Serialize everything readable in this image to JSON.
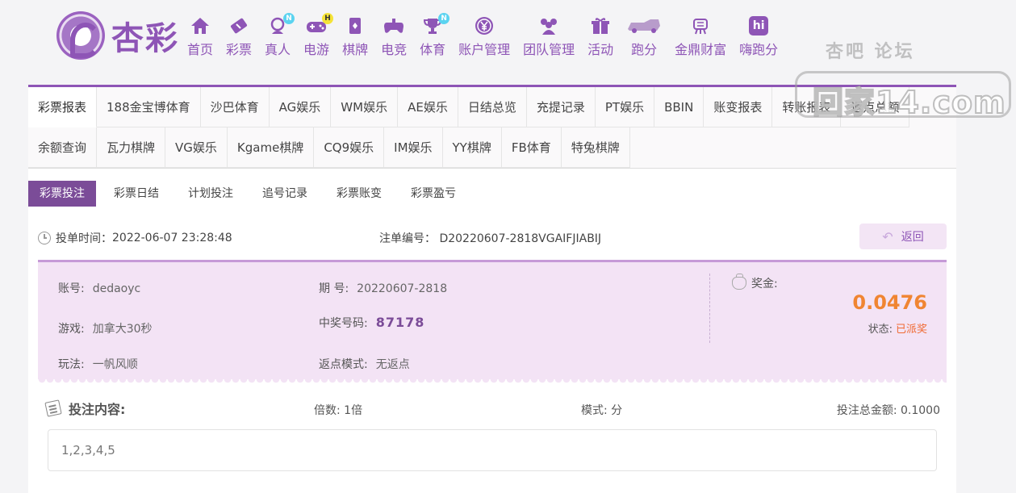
{
  "brand": {
    "name": "杏彩"
  },
  "nav": [
    {
      "label": "首页",
      "icon": "home-icon"
    },
    {
      "label": "彩票",
      "icon": "ticket-icon"
    },
    {
      "label": "真人",
      "icon": "person-icon",
      "badge": "N"
    },
    {
      "label": "电游",
      "icon": "gamepad-icon",
      "badge": "H"
    },
    {
      "label": "棋牌",
      "icon": "cards-icon"
    },
    {
      "label": "电竞",
      "icon": "controller-icon"
    },
    {
      "label": "体育",
      "icon": "trophy-icon",
      "badge": "N"
    },
    {
      "label": "账户管理",
      "icon": "yen-icon"
    },
    {
      "label": "团队管理",
      "icon": "team-icon"
    },
    {
      "label": "活动",
      "icon": "gift-icon"
    },
    {
      "label": "跑分",
      "icon": "vehicle-icon"
    },
    {
      "label": "金鼎财富",
      "icon": "ding-icon"
    },
    {
      "label": "嗨跑分",
      "icon": "hi-logo-icon",
      "logo_text": "hi"
    }
  ],
  "watermark": {
    "top": "杏吧    论坛",
    "main": "回家14.com"
  },
  "tabs_row1": [
    "彩票报表",
    "188金宝博体育",
    "沙巴体育",
    "AG娱乐",
    "WM娱乐",
    "AE娱乐",
    "日结总览",
    "充提记录",
    "PT娱乐",
    "BBIN",
    "账变报表",
    "转账报表",
    "返点总额"
  ],
  "tabs_row2": [
    "余额查询",
    "瓦力棋牌",
    "VG娱乐",
    "Kgame棋牌",
    "CQ9娱乐",
    "IM娱乐",
    "YY棋牌",
    "FB体育",
    "特兔棋牌"
  ],
  "subtabs": [
    "彩票投注",
    "彩票日结",
    "计划投注",
    "追号记录",
    "彩票账变",
    "彩票盈亏"
  ],
  "meta": {
    "time_label": "投单时间：",
    "time_value": "2022-06-07 23:28:48",
    "order_label": "注单编号：",
    "order_value": "D20220607-2818VGAIFJIABIJ",
    "back_label": "返回"
  },
  "info": {
    "account_label": "账号:",
    "account_value": "dedaoyc",
    "game_label": "游戏:",
    "game_value": "加拿大30秒",
    "play_label": "玩法:",
    "play_value": "一帆风顺",
    "period_label": "期 号:",
    "period_value": "20220607-2818",
    "winning_label": "中奖号码:",
    "winning_value": "87178",
    "rebate_label": "返点模式:",
    "rebate_value": "无返点",
    "prize_label": "奖金:",
    "prize_value": "0.0476",
    "status_label": "状态:",
    "status_value": "已派奖"
  },
  "bet": {
    "title": "投注内容:",
    "multiple_label": "倍数:",
    "multiple_value": "1倍",
    "mode_label": "模式:",
    "mode_value": "分",
    "total_label": "投注总金额:",
    "total_value": "0.1000",
    "content": "1,2,3,4,5"
  },
  "colors": {
    "accent": "#8e55b6",
    "active_subtab": "#7b4c98",
    "prize": "#f08532",
    "status": "#f06a32",
    "info_bg": "#f3e3f5"
  }
}
